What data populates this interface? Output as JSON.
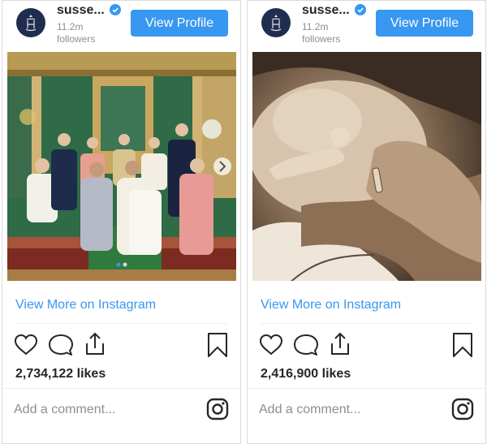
{
  "posts": [
    {
      "username": "susse...",
      "followers_count": "11.2m",
      "followers_label": "followers",
      "view_profile": "View Profile",
      "view_more": "View More on Instagram",
      "likes": "2,734,122 likes",
      "comment_placeholder": "Add a comment...",
      "photo": "royal-family-group-photo"
    },
    {
      "username": "susse...",
      "followers_count": "11.2m",
      "followers_label": "followers",
      "view_profile": "View Profile",
      "view_more": "View More on Instagram",
      "likes": "2,416,900 likes",
      "comment_placeholder": "Add a comment...",
      "photo": "baby-hand-sepia-photo"
    }
  ],
  "colors": {
    "accent": "#3897f0",
    "text": "#262626",
    "muted": "#8e8e8e",
    "avatar_bg": "#1f2d4f"
  },
  "icons": [
    "monogram-icon",
    "verified-icon",
    "heart-icon",
    "comment-icon",
    "share-icon",
    "bookmark-icon",
    "instagram-icon",
    "carousel-next-icon"
  ]
}
